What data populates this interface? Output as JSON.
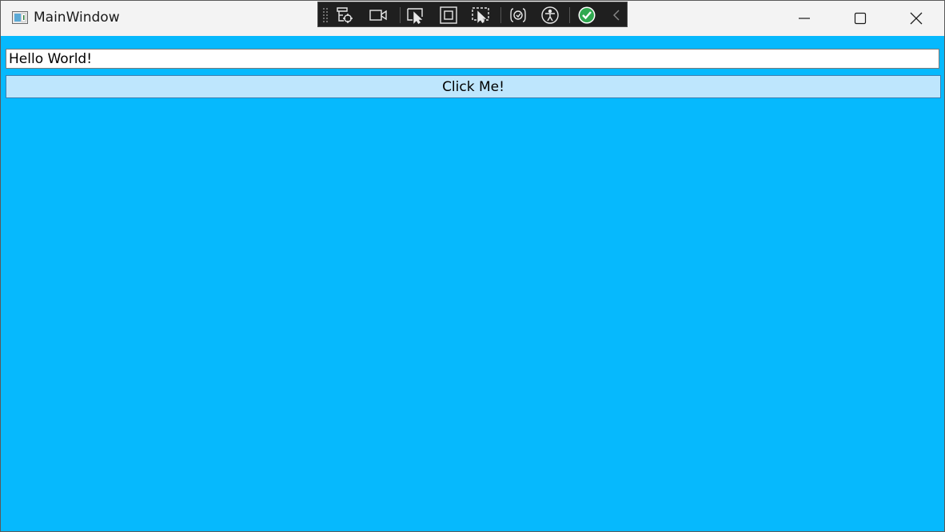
{
  "window": {
    "title": "MainWindow",
    "background_color": "#06b9fd"
  },
  "titlebar": {
    "minimize_icon": "minimize-icon",
    "maximize_icon": "maximize-icon",
    "close_icon": "close-icon"
  },
  "debug_toolbar": {
    "items": [
      "go-to-live-visual-tree-icon",
      "video-camera-icon",
      "select-element-icon",
      "display-layout-adorners-icon",
      "track-focused-element-icon",
      "hot-reload-icon",
      "accessibility-icon",
      "binding-failures-check-icon",
      "collapse-chevron-icon"
    ]
  },
  "content": {
    "textbox_value": "Hello World!",
    "button_label": "Click Me!",
    "textbox_bg": "#ffffff",
    "button_bg": "#bee6fd",
    "button_border": "#3c7fb1"
  }
}
